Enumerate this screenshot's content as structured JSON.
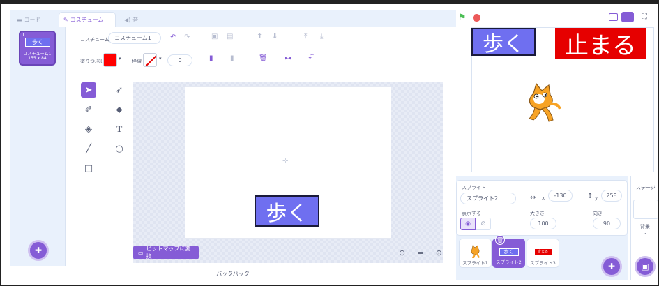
{
  "tabs": [
    {
      "label": "コード",
      "icon": "code-icon"
    },
    {
      "label": "コスチューム",
      "icon": "brush-icon"
    },
    {
      "label": "音",
      "icon": "speaker-icon"
    }
  ],
  "costume_list": [
    {
      "number": "1",
      "preview_text": "歩く",
      "name": "コスチューム1",
      "size": "155 x 84"
    }
  ],
  "editor": {
    "costume_label": "コスチューム",
    "costume_name": "コスチューム1",
    "fill_label": "塗りつぶし",
    "outline_label": "枠線",
    "outline_width": "0",
    "fill_color": "#ff0000",
    "convert_button": "ビットマップに変換",
    "zoom_out": "−",
    "zoom_reset": "=",
    "zoom_in": "+",
    "canvas_text": "歩く"
  },
  "backpack": "バックパック",
  "stage": {
    "walk_button": "歩く",
    "stop_button": "止まる"
  },
  "sprite_info": {
    "sprite_label": "スプライト",
    "sprite_name": "スプライト2",
    "x_label": "x",
    "x_value": "-130",
    "y_label": "y",
    "y_value": "258",
    "show_label": "表示する",
    "size_label": "大きさ",
    "size_value": "100",
    "direction_label": "向き",
    "direction_value": "90"
  },
  "sprites": [
    {
      "name": "スプライト1"
    },
    {
      "name": "スプライト2",
      "preview_text": "歩く"
    },
    {
      "name": "スプライト3",
      "preview_text": "止まる"
    }
  ],
  "stage_panel": {
    "label": "ステージ",
    "backdrop_label": "背景",
    "backdrop_count": "1"
  },
  "colors": {
    "accent": "#855cd6",
    "walk_blue": "#6f6ff0",
    "stop_red": "#e60000"
  }
}
